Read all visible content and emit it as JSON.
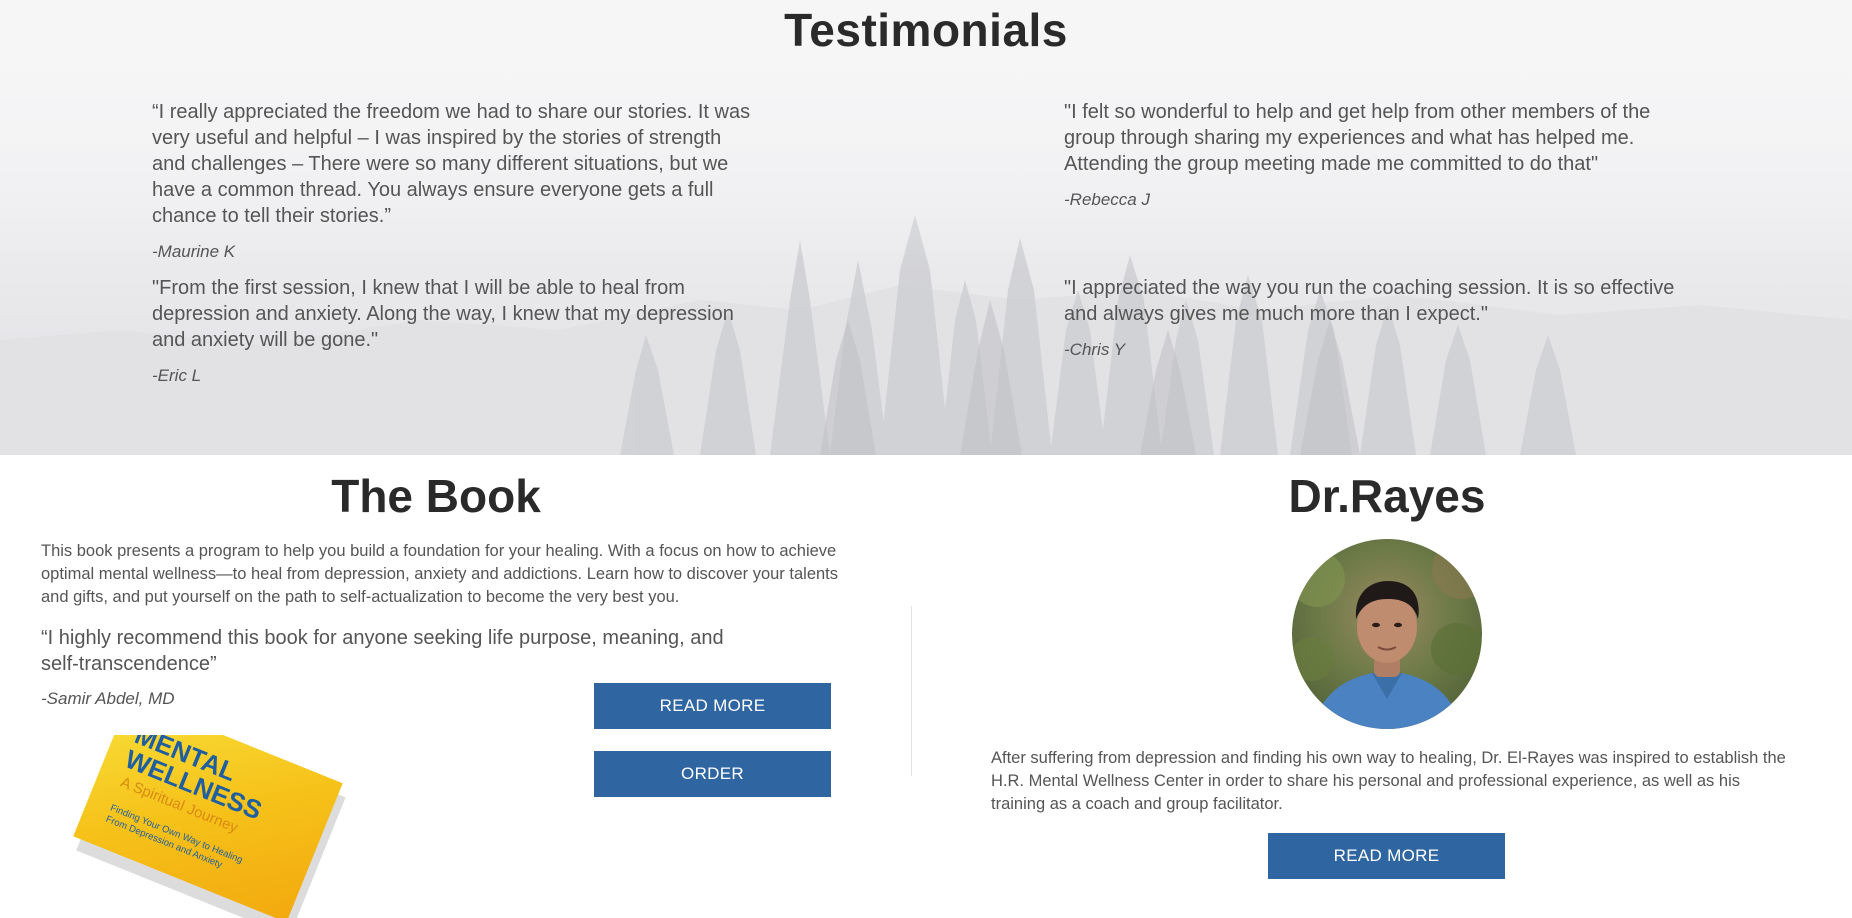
{
  "testimonials": {
    "title": "Testimonials",
    "items": [
      {
        "quote": "“I really appreciated the freedom we had to share our stories. It was very useful and helpful – I was inspired by the stories of strength and challenges – There were so many different situations, but we have a common thread. You always ensure everyone gets a full chance to tell their stories.”",
        "author": "-Maurine K"
      },
      {
        "quote": "\"I felt so wonderful to help and get help from other members of the group through sharing my experiences and what has helped me. Attending the group meeting made me committed to do that\"",
        "author": "-Rebecca J"
      },
      {
        "quote": "\"From the first session, I knew that I will be able to heal from depression and anxiety. Along the way, I knew that my depression and anxiety will be gone.\"",
        "author": "-Eric L"
      },
      {
        "quote": "\"I appreciated the way you run the coaching session. It is so effective and always gives me much more than I expect.\"",
        "author": "-Chris Y"
      }
    ]
  },
  "book": {
    "title": "The Book",
    "description": "This book presents a program to help you build a foundation for your healing. With a focus on how to achieve optimal mental wellness—to heal from depression, anxiety and addictions. Learn how to discover your talents and gifts, and put yourself on the path to self-actualization to become the very best you.",
    "quote": "“I highly recommend this book for anyone seeking life purpose, meaning, and self-transcendence”",
    "quote_author": "-Samir Abdel, MD",
    "read_more_label": "READ MORE",
    "order_label": "ORDER",
    "cover": {
      "title_line1": "MENTAL",
      "title_line2": "WELLNESS",
      "subtitle": "A Spiritual Journey",
      "tagline1": "Finding Your Own Way to Healing",
      "tagline2": "From Depression and Anxiety"
    }
  },
  "doctor": {
    "title": "Dr.Rayes",
    "bio": "After suffering from depression and finding his own way to healing, Dr. El-Rayes was inspired to establish the H.R. Mental Wellness Center in order to share his personal and professional experience, as well as his training as a coach and group facilitator.",
    "read_more_label": "READ MORE"
  },
  "colors": {
    "button": "#2f66a2",
    "heading": "#2a2a2a",
    "body_text": "#555555"
  }
}
